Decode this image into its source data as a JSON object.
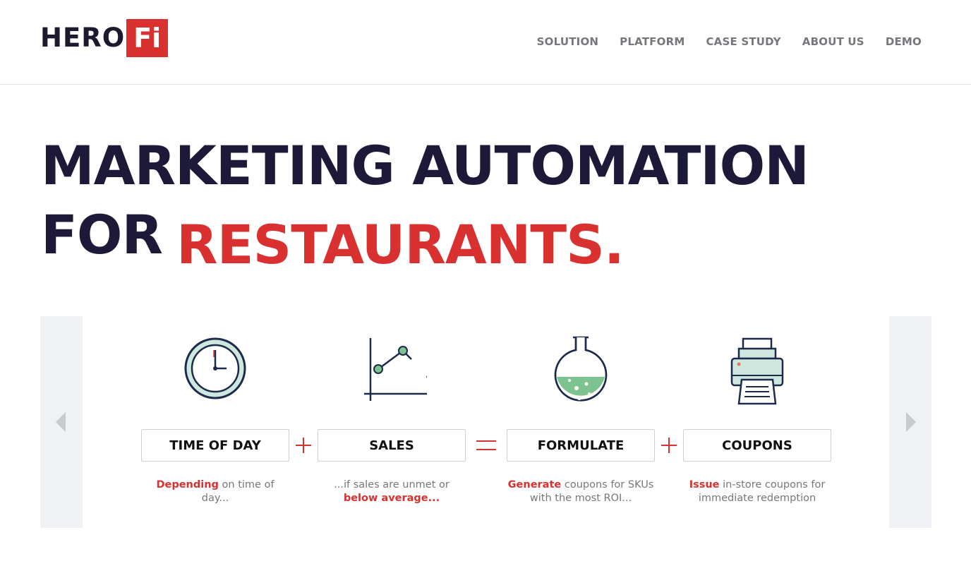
{
  "brand": {
    "name_part1": "HERO",
    "name_part2": "Fi",
    "accent_color": "#d9312f",
    "dark_color": "#1c1a38"
  },
  "nav": {
    "items": [
      {
        "label": "SOLUTION"
      },
      {
        "label": "PLATFORM"
      },
      {
        "label": "CASE STUDY"
      },
      {
        "label": "ABOUT US"
      },
      {
        "label": "DEMO"
      }
    ]
  },
  "hero": {
    "line1": "MARKETING AUTOMATION",
    "line2_dark": "FOR",
    "line2_red": "RESTAURANTS."
  },
  "carousel": {
    "prev_icon": "chevron-left-icon",
    "next_icon": "chevron-right-icon",
    "steps": [
      {
        "icon": "clock-icon",
        "label": "TIME OF DAY",
        "desc_highlight": "Depending",
        "desc_rest": " on time of day..."
      },
      {
        "icon": "line-chart-icon",
        "label": "SALES",
        "desc_pre": "...if sales are unmet or ",
        "desc_highlight": "below average..."
      },
      {
        "icon": "flask-icon",
        "label": "FORMULATE",
        "desc_highlight": "Generate",
        "desc_rest": " coupons for SKUs with the most ROI..."
      },
      {
        "icon": "printer-icon",
        "label": "COUPONS",
        "desc_highlight": "Issue",
        "desc_rest": " in-store coupons for immediate redemption"
      }
    ],
    "operators": [
      "plus",
      "equals",
      "plus"
    ]
  }
}
